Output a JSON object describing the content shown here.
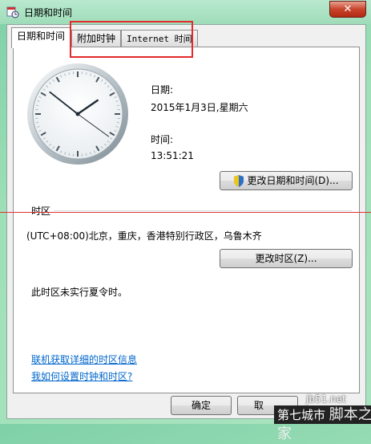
{
  "window": {
    "title": "日期和时间",
    "close_label": "✕"
  },
  "tabs": [
    {
      "label": "日期和时间",
      "active": true
    },
    {
      "label": "附加时钟",
      "active": false
    },
    {
      "label": "Internet 时间",
      "active": false
    }
  ],
  "datetime": {
    "date_label": "日期:",
    "date_value": "2015年1月3日,星期六",
    "time_label": "时间:",
    "time_value": "13:51:21",
    "change_datetime_button": "更改日期和时间(D)..."
  },
  "clock": {
    "hours": 13,
    "minutes": 51,
    "seconds": 21
  },
  "timezone": {
    "section_label": "时区",
    "value": "(UTC+08:00)北京，重庆，香港特别行政区，乌鲁木齐",
    "change_timezone_button": "更改时区(Z)...",
    "dst_note": "此时区未实行夏令时。"
  },
  "links": {
    "online_info": "联机获取详细的时区信息",
    "how_to": "我如何设置时钟和时区?"
  },
  "footer": {
    "ok_button": "确定",
    "cancel_button": "取"
  },
  "watermark": {
    "site": "jb51.net",
    "brand_a": "第七城市",
    "brand_b": "脚本之家"
  },
  "colors": {
    "highlight": "#e32b2b",
    "link": "#0066cc",
    "shield_blue": "#2c6fc7",
    "shield_yellow": "#f0c419"
  }
}
